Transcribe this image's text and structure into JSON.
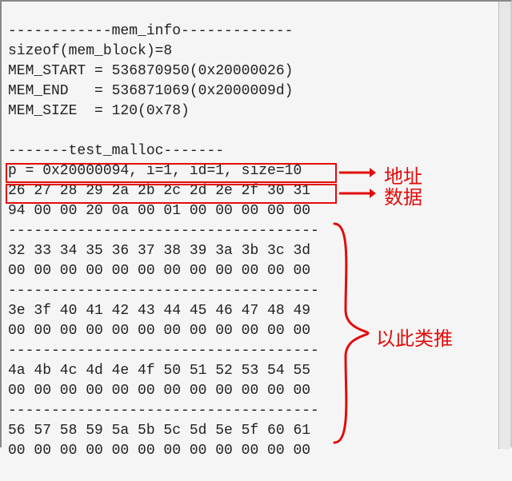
{
  "lines": [
    "------------mem_info-------------",
    "sizeof(mem_block)=8",
    "MEM_START = 536870950(0x20000026)",
    "MEM_END   = 536871069(0x2000009d)",
    "MEM_SIZE  = 120(0x78)",
    "",
    "-------test_malloc-------",
    "p = 0x20000094, i=1, id=1, size=10",
    "26 27 28 29 2a 2b 2c 2d 2e 2f 30 31",
    "94 00 00 20 0a 00 01 00 00 00 00 00",
    "------------------------------------",
    "32 33 34 35 36 37 38 39 3a 3b 3c 3d",
    "00 00 00 00 00 00 00 00 00 00 00 00",
    "------------------------------------",
    "3e 3f 40 41 42 43 44 45 46 47 48 49",
    "00 00 00 00 00 00 00 00 00 00 00 00",
    "------------------------------------",
    "4a 4b 4c 4d 4e 4f 50 51 52 53 54 55",
    "00 00 00 00 00 00 00 00 00 00 00 00",
    "------------------------------------",
    "56 57 58 59 5a 5b 5c 5d 5e 5f 60 61",
    "00 00 00 00 00 00 00 00 00 00 00 00"
  ],
  "annotations": {
    "address_label": "地址",
    "data_label": "数据",
    "etc_label": "以此类推"
  },
  "colors": {
    "highlight": "#e30b0b"
  }
}
